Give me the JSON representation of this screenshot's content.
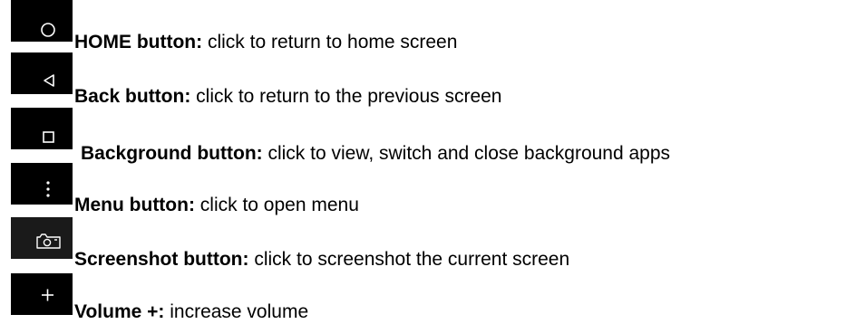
{
  "items": [
    {
      "icon": "circle-icon",
      "title": "HOME button:",
      "description": " click to return to home screen"
    },
    {
      "icon": "triangle-back-icon",
      "title": "Back button:",
      "description": " click to return to the previous screen"
    },
    {
      "icon": "square-icon",
      "title": "Background button:",
      "description": " click to view, switch and close background apps"
    },
    {
      "icon": "vertical-dots-icon",
      "title": "Menu button:",
      "description": " click to open menu"
    },
    {
      "icon": "camera-icon",
      "title": "Screenshot button:",
      "description": " click to screenshot the current screen"
    },
    {
      "icon": "plus-icon",
      "title": "Volume +:",
      "description": " increase volume"
    }
  ],
  "colors": {
    "icon_background": "#000000",
    "icon_foreground": "#ffffff",
    "screenshot_icon_background": "#1a1a1a"
  }
}
